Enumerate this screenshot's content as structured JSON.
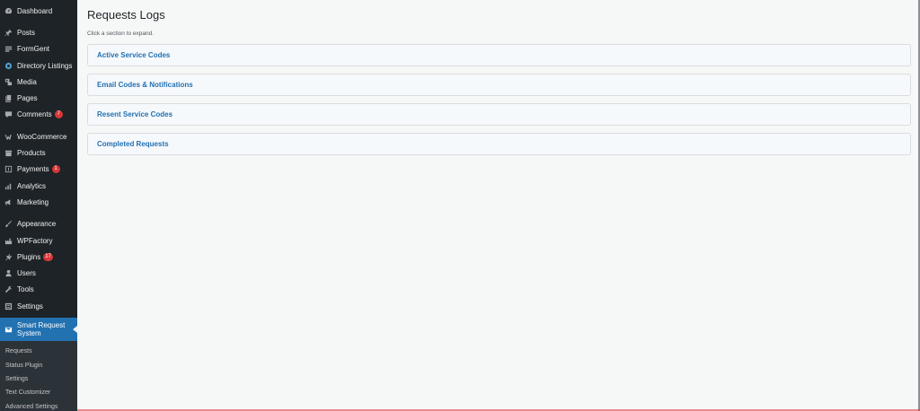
{
  "sidebar": {
    "items": [
      {
        "label": "Dashboard",
        "icon": "dashboard-icon",
        "badge": ""
      },
      {
        "label": "Posts",
        "icon": "pin-icon",
        "badge": ""
      },
      {
        "label": "FormGent",
        "icon": "form-icon",
        "badge": ""
      },
      {
        "label": "Directory Listings",
        "icon": "listings-icon",
        "badge": ""
      },
      {
        "label": "Media",
        "icon": "media-icon",
        "badge": ""
      },
      {
        "label": "Pages",
        "icon": "pages-icon",
        "badge": ""
      },
      {
        "label": "Comments",
        "icon": "comment-icon",
        "badge": "7"
      },
      {
        "label": "WooCommerce",
        "icon": "woocommerce-icon",
        "badge": ""
      },
      {
        "label": "Products",
        "icon": "products-icon",
        "badge": ""
      },
      {
        "label": "Payments",
        "icon": "payments-icon",
        "badge": "1"
      },
      {
        "label": "Analytics",
        "icon": "analytics-icon",
        "badge": ""
      },
      {
        "label": "Marketing",
        "icon": "megaphone-icon",
        "badge": ""
      },
      {
        "label": "Appearance",
        "icon": "brush-icon",
        "badge": ""
      },
      {
        "label": "WPFactory",
        "icon": "factory-icon",
        "badge": ""
      },
      {
        "label": "Plugins",
        "icon": "plugin-icon",
        "badge": "17"
      },
      {
        "label": "Users",
        "icon": "user-icon",
        "badge": ""
      },
      {
        "label": "Tools",
        "icon": "wrench-icon",
        "badge": ""
      },
      {
        "label": "Settings",
        "icon": "settings-icon",
        "badge": ""
      }
    ],
    "active": {
      "label": "Smart Request System",
      "icon": "mail-icon"
    },
    "submenu": [
      "Requests",
      "Status Plugin",
      "Settings",
      "Text Customizer",
      "Advanced Settings"
    ]
  },
  "main": {
    "title": "Requests Logs",
    "hint": "Click a section to expand.",
    "sections": [
      "Active Service Codes",
      "Email Codes & Notifications",
      "Resent Service Codes",
      "Completed Requests"
    ]
  },
  "colors": {
    "sidebar_bg": "#1d2327",
    "active_bg": "#2271b1",
    "badge": "#d63638",
    "section_label": "#2271b1"
  }
}
